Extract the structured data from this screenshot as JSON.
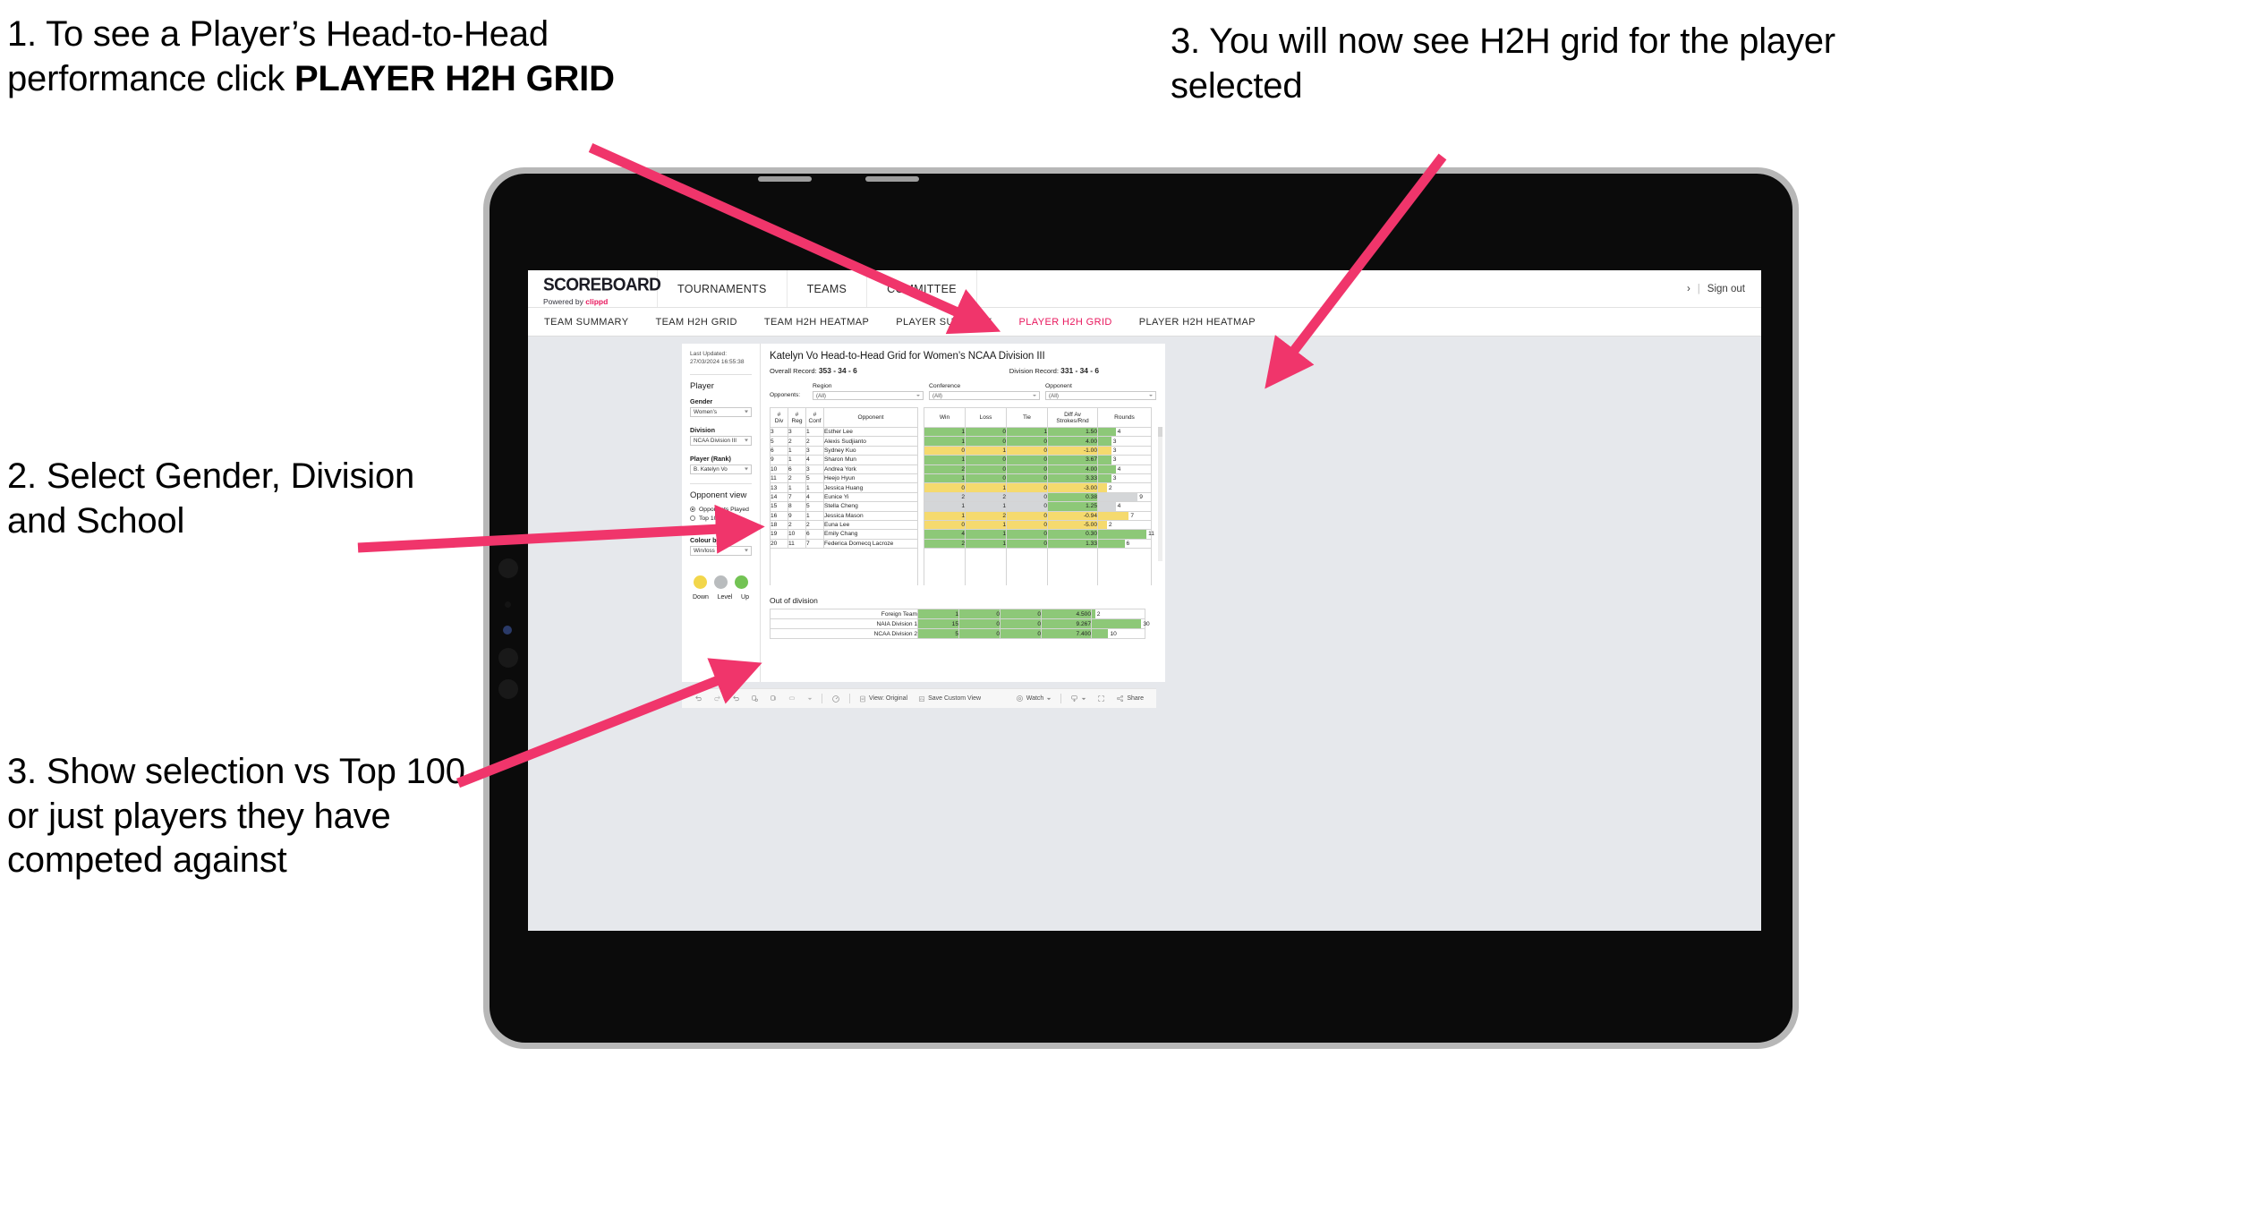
{
  "annotations": {
    "a1_prefix": "1. To see a Player’s Head-to-Head performance click ",
    "a1_bold": "PLAYER H2H GRID",
    "a2": "2. Select Gender, Division and School",
    "a3": "3. Show selection vs Top 100 or just players they have competed against",
    "a4": "3. You will now see H2H grid for the player selected"
  },
  "brand": {
    "logo": "SCOREBOARD",
    "powered_prefix": "Powered by ",
    "powered_name": "clippd"
  },
  "topnav": {
    "items": [
      {
        "label": "TOURNAMENTS"
      },
      {
        "label": "TEAMS"
      },
      {
        "label": "COMMITTEE"
      }
    ],
    "right_chevron": "›",
    "right_sep": "|",
    "sign_out": "Sign out"
  },
  "subnav": {
    "items": [
      {
        "label": "TEAM SUMMARY",
        "active": false
      },
      {
        "label": "TEAM H2H GRID",
        "active": false
      },
      {
        "label": "TEAM H2H HEATMAP",
        "active": false
      },
      {
        "label": "PLAYER SUMMARY",
        "active": false
      },
      {
        "label": "PLAYER H2H GRID",
        "active": true
      },
      {
        "label": "PLAYER H2H HEATMAP",
        "active": false
      }
    ],
    "active_color": "#e8175d"
  },
  "sidepanel": {
    "last_updated": "Last Updated: 27/03/2024 16:55:38",
    "player_heading": "Player",
    "gender_label": "Gender",
    "gender_value": "Women’s",
    "division_label": "Division",
    "division_value": "NCAA Division III",
    "player_label": "Player (Rank)",
    "player_value": "B. Katelyn Vo",
    "opponent_view_heading": "Opponent view",
    "radio_opponents_played": "Opponents Played",
    "radio_top100": "Top 100",
    "colour_by_label": "Colour by",
    "colour_by_value": "Win/loss",
    "legend": [
      {
        "label": "Down",
        "color": "#f2d64b"
      },
      {
        "label": "Level",
        "color": "#b9bcbe"
      },
      {
        "label": "Up",
        "color": "#73c354"
      }
    ]
  },
  "main": {
    "title": "Katelyn Vo Head-to-Head Grid for Women’s NCAA Division III",
    "overall_record_label": "Overall Record:",
    "overall_record_value": "353 - 34 - 6",
    "division_record_label": "Division Record:",
    "division_record_value": "331 - 34 - 6",
    "opponents_label": "Opponents:",
    "filters": [
      {
        "label": "Region",
        "value": "(All)"
      },
      {
        "label": "Conference",
        "value": "(All)"
      },
      {
        "label": "Opponent",
        "value": "(All)"
      }
    ],
    "out_of_division_title": "Out of division"
  },
  "chart_data": {
    "type": "table",
    "title": "Katelyn Vo Head-to-Head Grid for Women’s NCAA Division III",
    "columns": [
      "# Div",
      "# Reg",
      "# Conf",
      "Opponent",
      "Win",
      "Loss",
      "Tie",
      "Diff Av Strokes/Rnd",
      "Rounds"
    ],
    "column_headers_multiline": [
      {
        "l1": "#",
        "l2": "Div"
      },
      {
        "l1": "#",
        "l2": "Reg"
      },
      {
        "l1": "#",
        "l2": "Conf"
      },
      {
        "l1": "Opponent",
        "l2": ""
      },
      {
        "l1": "Win",
        "l2": ""
      },
      {
        "l1": "Loss",
        "l2": ""
      },
      {
        "l1": "Tie",
        "l2": ""
      },
      {
        "l1": "Diff Av",
        "l2": "Strokes/Rnd"
      },
      {
        "l1": "Rounds",
        "l2": ""
      }
    ],
    "colors": {
      "up": "#8dc878",
      "down": "#f5da6e",
      "level": "#d4d6d8"
    },
    "rounds_max": 12,
    "rows": [
      {
        "div": "3",
        "reg": "3",
        "conf": "1",
        "opponent": "Esther Lee",
        "win": "1",
        "loss": "0",
        "tie": "1",
        "diff": "1.50",
        "rounds": "4",
        "state": "up"
      },
      {
        "div": "5",
        "reg": "2",
        "conf": "2",
        "opponent": "Alexis Sudjianto",
        "win": "1",
        "loss": "0",
        "tie": "0",
        "diff": "4.00",
        "rounds": "3",
        "state": "up"
      },
      {
        "div": "6",
        "reg": "1",
        "conf": "3",
        "opponent": "Sydney Kuo",
        "win": "0",
        "loss": "1",
        "tie": "0",
        "diff": "-1.00",
        "rounds": "3",
        "state": "down"
      },
      {
        "div": "9",
        "reg": "1",
        "conf": "4",
        "opponent": "Sharon Mun",
        "win": "1",
        "loss": "0",
        "tie": "0",
        "diff": "3.67",
        "rounds": "3",
        "state": "up"
      },
      {
        "div": "10",
        "reg": "6",
        "conf": "3",
        "opponent": "Andrea York",
        "win": "2",
        "loss": "0",
        "tie": "0",
        "diff": "4.00",
        "rounds": "4",
        "state": "up"
      },
      {
        "div": "11",
        "reg": "2",
        "conf": "5",
        "opponent": "Heejo Hyun",
        "win": "1",
        "loss": "0",
        "tie": "0",
        "diff": "3.33",
        "rounds": "3",
        "state": "up"
      },
      {
        "div": "13",
        "reg": "1",
        "conf": "1",
        "opponent": "Jessica Huang",
        "win": "0",
        "loss": "1",
        "tie": "0",
        "diff": "-3.00",
        "rounds": "2",
        "state": "down"
      },
      {
        "div": "14",
        "reg": "7",
        "conf": "4",
        "opponent": "Eunice Yi",
        "win": "2",
        "loss": "2",
        "tie": "0",
        "diff": "0.38",
        "rounds": "9",
        "state": "level",
        "diff_state": "up"
      },
      {
        "div": "15",
        "reg": "8",
        "conf": "5",
        "opponent": "Stella Cheng",
        "win": "1",
        "loss": "1",
        "tie": "0",
        "diff": "1.25",
        "rounds": "4",
        "state": "level",
        "diff_state": "up"
      },
      {
        "div": "16",
        "reg": "9",
        "conf": "1",
        "opponent": "Jessica Mason",
        "win": "1",
        "loss": "2",
        "tie": "0",
        "diff": "-0.94",
        "rounds": "7",
        "state": "down"
      },
      {
        "div": "18",
        "reg": "2",
        "conf": "2",
        "opponent": "Euna Lee",
        "win": "0",
        "loss": "1",
        "tie": "0",
        "diff": "-5.00",
        "rounds": "2",
        "state": "down"
      },
      {
        "div": "19",
        "reg": "10",
        "conf": "6",
        "opponent": "Emily Chang",
        "win": "4",
        "loss": "1",
        "tie": "0",
        "diff": "0.30",
        "rounds": "11",
        "state": "up"
      },
      {
        "div": "20",
        "reg": "11",
        "conf": "7",
        "opponent": "Federica Domecq Lacroze",
        "win": "2",
        "loss": "1",
        "tie": "0",
        "diff": "1.33",
        "rounds": "6",
        "state": "up"
      }
    ],
    "out_of_division": {
      "rounds_max": 32,
      "rows": [
        {
          "name": "Foreign Team",
          "win": "1",
          "loss": "0",
          "tie": "0",
          "diff": "4.500",
          "rounds": "2",
          "state": "up"
        },
        {
          "name": "NAIA Division 1",
          "win": "15",
          "loss": "0",
          "tie": "0",
          "diff": "9.267",
          "rounds": "30",
          "state": "up"
        },
        {
          "name": "NCAA Division 2",
          "win": "5",
          "loss": "0",
          "tie": "0",
          "diff": "7.400",
          "rounds": "10",
          "state": "up"
        }
      ]
    }
  },
  "toolbar": {
    "view_label": "View: Original",
    "save_label": "Save Custom View",
    "watch_label": "Watch",
    "share_label": "Share"
  }
}
